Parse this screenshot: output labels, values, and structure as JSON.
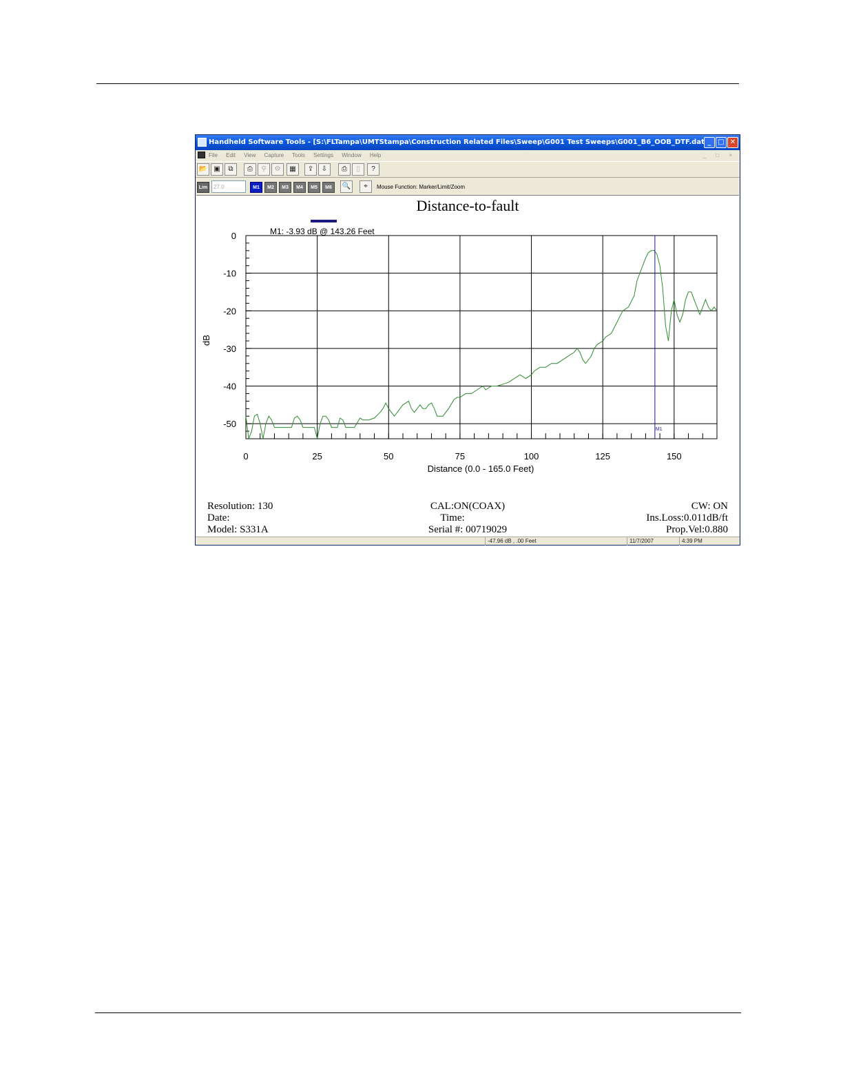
{
  "window": {
    "title": "Handheld Software Tools - [S:\\FLTampa\\UMTStampa\\Construction Related Files\\Sweep\\G001 Test Sweeps\\G001_B6_OOB_DTF.dat]",
    "minimize_glyph": "_",
    "maximize_glyph": "□",
    "close_glyph": "✕"
  },
  "menu": {
    "items": [
      "File",
      "Edit",
      "View",
      "Capture",
      "Tools",
      "Settings",
      "Window",
      "Help"
    ],
    "mdi_controls": "_ □ ×"
  },
  "toolbar": {
    "icons": [
      "open-folder-icon",
      "save-icon",
      "copy-icon",
      "capture-icon",
      "antenna-icon",
      "gear-icon",
      "calculator-icon",
      "upload-icon",
      "download-icon",
      "printer-icon",
      "document-icon",
      "help-icon"
    ]
  },
  "markerbar": {
    "lim_label": "Lim",
    "lim_value": "27.0",
    "markers": [
      "M1",
      "M2",
      "M3",
      "M4",
      "M5",
      "M6"
    ],
    "active_marker": "M1",
    "mouse_function": "Mouse Function: Marker/Limit/Zoom"
  },
  "chart_data": {
    "type": "line",
    "title": "Distance-to-fault",
    "xlabel": "Distance (0.0 - 165.0 Feet)",
    "ylabel": "dB",
    "xlim": [
      0,
      165
    ],
    "ylim": [
      -54,
      0
    ],
    "x_ticks": [
      0,
      25,
      50,
      75,
      100,
      125,
      150
    ],
    "y_ticks": [
      0,
      -10,
      -20,
      -30,
      -40,
      -50
    ],
    "grid": true,
    "marker_readout": "M1: -3.93 dB @ 143.26 Feet",
    "marker": {
      "label": "M1",
      "x": 143.26,
      "y": -3.93
    },
    "limit_line": -50,
    "series": [
      {
        "color": "#2e8b2e",
        "x": [
          0,
          1,
          2,
          3,
          4,
          5,
          6,
          7,
          8,
          9,
          10,
          11,
          12,
          14,
          16,
          17,
          18,
          19,
          20,
          22,
          24,
          25,
          26,
          27,
          28,
          29,
          30,
          32,
          33,
          34,
          35,
          36,
          38,
          40,
          41,
          43,
          45,
          47,
          48,
          49,
          50,
          51,
          52,
          53,
          55,
          57,
          58,
          59,
          60,
          61,
          62,
          63,
          64,
          65,
          66,
          67,
          68,
          69,
          71,
          73,
          74,
          75,
          77,
          79,
          81,
          83,
          84,
          86,
          88,
          90,
          92,
          94,
          96,
          98,
          100,
          101,
          103,
          105,
          107,
          109,
          111,
          113,
          115,
          116,
          117,
          118,
          119,
          121,
          122,
          123,
          125,
          126,
          128,
          130,
          132,
          134,
          136,
          137,
          139,
          140,
          141,
          142,
          143,
          144,
          145,
          146,
          147,
          148,
          149,
          150,
          151,
          152,
          153,
          154,
          155,
          156,
          157,
          158,
          159,
          160,
          161,
          162,
          163,
          164,
          165
        ],
        "y": [
          -48,
          -54,
          -52,
          -48,
          -47.5,
          -50,
          -54,
          -50,
          -48,
          -49,
          -51,
          -51,
          -51,
          -51,
          -51,
          -48.5,
          -48,
          -49,
          -51,
          -51,
          -51,
          -54,
          -50,
          -48,
          -48,
          -49,
          -51,
          -51,
          -48.5,
          -49,
          -51,
          -51,
          -51,
          -48.5,
          -49,
          -49,
          -48.5,
          -47,
          -46,
          -44.5,
          -46,
          -47,
          -48,
          -47,
          -45,
          -44,
          -46,
          -47,
          -46,
          -45,
          -46,
          -46,
          -45,
          -44.5,
          -46,
          -48,
          -48,
          -48,
          -46,
          -43.5,
          -43,
          -43,
          -42,
          -42,
          -41,
          -40,
          -41,
          -40,
          -40,
          -39.5,
          -39,
          -38,
          -37,
          -38,
          -37,
          -36,
          -35,
          -35,
          -34,
          -34,
          -33,
          -32,
          -31,
          -30,
          -31,
          -33,
          -34,
          -32,
          -30,
          -29,
          -28,
          -27,
          -26,
          -23,
          -20,
          -19,
          -16,
          -12,
          -8,
          -6,
          -4.5,
          -4,
          -3.93,
          -5,
          -8,
          -14,
          -24,
          -28,
          -20,
          -17,
          -21,
          -23,
          -21,
          -17,
          -15,
          -15,
          -17,
          -19,
          -21,
          -19,
          -17,
          -19,
          -20,
          -19,
          -20
        ]
      }
    ]
  },
  "info": {
    "resolution": "Resolution:  130",
    "cal": "CAL:ON(COAX)",
    "cw": "CW: ON",
    "date": "Date:",
    "time": "Time:",
    "ins_loss": "Ins.Loss:0.011dB/ft",
    "model": "Model: S331A",
    "serial": "Serial #: 00719029",
    "prop_vel": "Prop.Vel:0.880"
  },
  "status": {
    "readout": "-47.96 dB   ,   .00 Feet",
    "date": "11/7/2007",
    "time": "4:39 PM"
  }
}
